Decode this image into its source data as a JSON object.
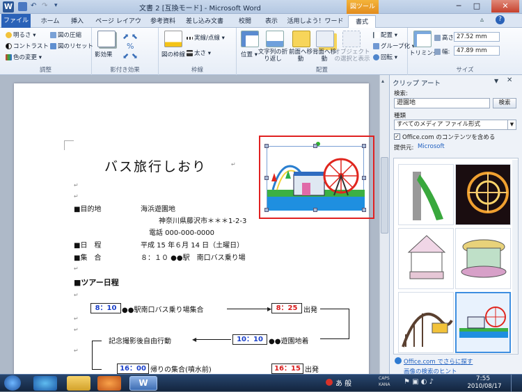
{
  "window": {
    "title": "文書 2 [互換モード] - Microsoft Word",
    "context_tab": "図ツール",
    "min": "─",
    "max": "□",
    "close": "✕"
  },
  "tabs": [
    "ファイル",
    "ホーム",
    "挿入",
    "ページ レイアウト",
    "参考資料",
    "差し込み文書",
    "校閲",
    "表示",
    "活用しよう！ワード",
    "書式"
  ],
  "ribbon": {
    "adjust": {
      "label": "調整",
      "brightness": "明るさ",
      "contrast": "コントラスト",
      "recolor": "色の変更",
      "compress": "図の圧縮",
      "reset": "図のリセット"
    },
    "effects": {
      "label": "影付き効果",
      "shadow": "影効果"
    },
    "border": {
      "label": "枠線",
      "picture_border": "図の枠線",
      "dash": "実線/点線",
      "weight": "太さ"
    },
    "arrange": {
      "label": "配置",
      "position": "位置",
      "wrap": "文字列の折り返し",
      "front": "前面へ移動",
      "back": "背面へ移動",
      "selection": "オブジェクトの選択と表示",
      "align": "配置",
      "group": "グループ化",
      "rotate": "回転"
    },
    "size": {
      "label": "サイズ",
      "crop": "トリミング",
      "height_label": "高さ:",
      "height": "27.52 mm",
      "width_label": "幅:",
      "width": "47.89 mm"
    }
  },
  "doc": {
    "title": "バス旅行しおり",
    "dest_label": "■目的地",
    "dest_name": "海浜遊園地",
    "dest_addr": "神奈川県藤沢市＊＊＊1-2-3",
    "dest_tel": "電話 000-000-0000",
    "date_label": "■日　程",
    "date_val": "平成 15 年６月 14 日（土曜日）",
    "meet_label": "■集　合",
    "meet_val": "８：１０ ●●駅　南口バス乗り場",
    "tour_label": "■ツアー日程",
    "t1_time": "8：10",
    "t1_text": "●●駅南口バス乗り場集合",
    "t2_time": "8：25",
    "t2_text": "出発",
    "t3_text": "記念撮影後自由行動",
    "t4_time": "10：10",
    "t4_text": "●●遊園地着",
    "t5_time": "16：00",
    "t5_text": "帰りの集合(噴水前)",
    "t6_time": "16：15",
    "t6_text": "出発"
  },
  "clipart": {
    "title": "クリップ アート",
    "search_label": "検索:",
    "search_value": "遊園地",
    "search_btn": "検索",
    "type_label": "種類",
    "type_value": "すべてのメディア ファイル形式",
    "office_check": "Office.com のコンテンツを含める",
    "source_label": "提供元:",
    "source_value": "Microsoft",
    "more_link": "Office.com でさらに探す",
    "hint": "画像の検索のヒント"
  },
  "taskbar": {
    "ime_mode": "あ 般",
    "caps": "CAPS",
    "kana": "KANA",
    "time": "7:55",
    "date": "2010/08/17"
  },
  "colors": {
    "accent": "#2a62b8",
    "context": "#e28c1f",
    "selection": "#e02020"
  }
}
